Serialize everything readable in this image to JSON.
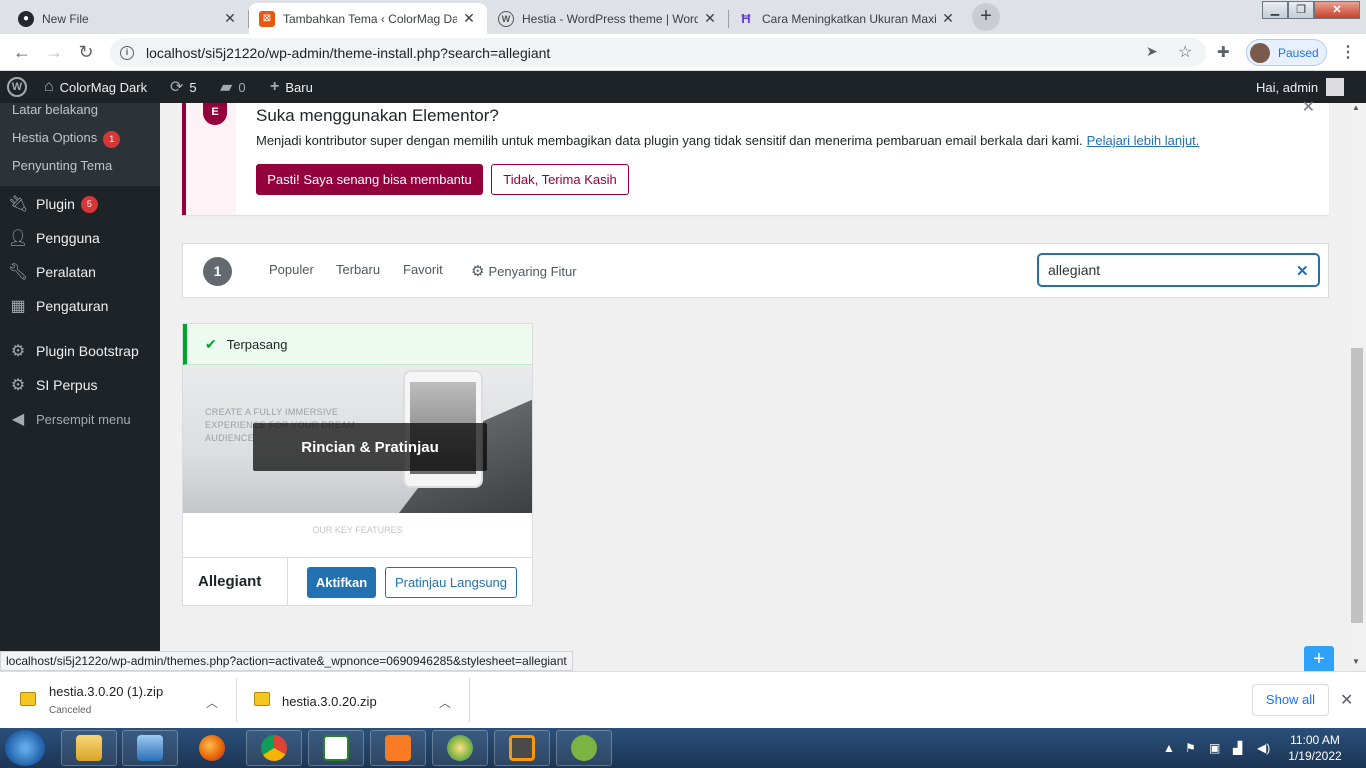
{
  "browser": {
    "tabs": [
      {
        "title": "New File",
        "icon": "github-icon",
        "active": false
      },
      {
        "title": "Tambahkan Tema ‹ ColorMag Dark",
        "icon": "wp-theme-icon",
        "active": true
      },
      {
        "title": "Hestia - WordPress theme | Word",
        "icon": "wordpress-icon",
        "active": false
      },
      {
        "title": "Cara Meningkatkan Ukuran Maxi",
        "icon": "article-icon",
        "active": false
      }
    ],
    "url": "localhost/si5j2122o/wp-admin/theme-install.php?search=allegiant",
    "profile_status": "Paused",
    "accent": "#1a73e8"
  },
  "adminbar": {
    "site_name": "ColorMag Dark",
    "updates": "5",
    "comments": "0",
    "new_label": "Baru",
    "greeting": "Hai, admin"
  },
  "sidebar": {
    "submenu": [
      {
        "label": "Latar belakang"
      },
      {
        "label": "Hestia Options",
        "badge": "1"
      },
      {
        "label": "Penyunting Tema"
      }
    ],
    "items": [
      {
        "label": "Plugin",
        "icon": "plugin-icon",
        "badge": "5"
      },
      {
        "label": "Pengguna",
        "icon": "users-icon"
      },
      {
        "label": "Peralatan",
        "icon": "tools-icon"
      },
      {
        "label": "Pengaturan",
        "icon": "settings-icon"
      },
      {
        "label": "Plugin Bootstrap",
        "icon": "gear-icon"
      },
      {
        "label": "SI Perpus",
        "icon": "gear-icon"
      },
      {
        "label": "Persempit menu",
        "icon": "collapse-icon"
      }
    ]
  },
  "notice": {
    "title": "Suka menggunakan Elementor?",
    "text": "Menjadi kontributor super dengan memilih untuk membagikan data plugin yang tidak sensitif dan menerima pembaruan email berkala dari kami.",
    "link": "Pelajari lebih lanjut.",
    "primary_button": "Pasti! Saya senang bisa membantu",
    "secondary_button": "Tidak, Terima Kasih",
    "brand_color": "#93003c"
  },
  "filter": {
    "count": "1",
    "links": [
      "Populer",
      "Terbaru",
      "Favorit"
    ],
    "feature_filter": "Penyaring Fitur",
    "search_value": "allegiant"
  },
  "theme": {
    "installed_label": "Terpasang",
    "overlay_label": "Rincian & Pratinjau",
    "screenshot_text": [
      "CREATE A FULLY IMMERSIVE",
      "EXPERIENCE FOR YOUR DREAM",
      "AUDIENCE",
      "OUR KEY FEATURES"
    ],
    "name": "Allegiant",
    "activate_button": "Aktifkan",
    "preview_button": "Pratinjau Langsung"
  },
  "status_url": "localhost/si5j2122o/wp-admin/themes.php?action=activate&_wpnonce=0690946285&stylesheet=allegiant",
  "downloads": [
    {
      "name": "hestia.3.0.20 (1).zip",
      "status": "Canceled"
    },
    {
      "name": "hestia.3.0.20.zip",
      "status": ""
    }
  ],
  "downloads_show_all": "Show all",
  "taskbar": {
    "time": "11:00 AM",
    "date": "1/19/2022"
  }
}
